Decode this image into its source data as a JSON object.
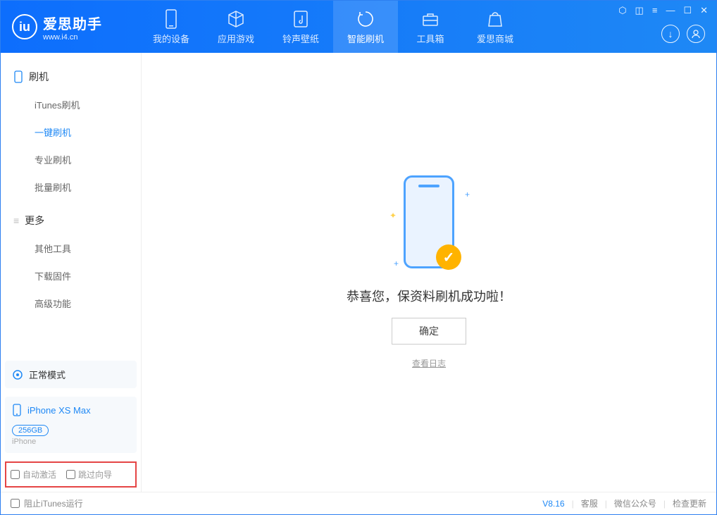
{
  "app": {
    "title": "爱思助手",
    "subtitle": "www.i4.cn"
  },
  "tabs": {
    "device": "我的设备",
    "apps": "应用游戏",
    "ring": "铃声壁纸",
    "flash": "智能刷机",
    "tools": "工具箱",
    "store": "爱思商城"
  },
  "sidebar": {
    "flash_head": "刷机",
    "itunes_flash": "iTunes刷机",
    "one_click": "一键刷机",
    "pro_flash": "专业刷机",
    "batch_flash": "批量刷机",
    "more_head": "更多",
    "other_tools": "其他工具",
    "download_fw": "下载固件",
    "advanced": "高级功能"
  },
  "device": {
    "mode": "正常模式",
    "name": "iPhone XS Max",
    "capacity": "256GB",
    "type": "iPhone"
  },
  "checks": {
    "auto_activate": "自动激活",
    "skip_wizard": "跳过向导"
  },
  "main": {
    "success": "恭喜您，保资料刷机成功啦！",
    "ok": "确定",
    "view_log": "查看日志"
  },
  "footer": {
    "block_itunes": "阻止iTunes运行",
    "version": "V8.16",
    "kefu": "客服",
    "wechat": "微信公众号",
    "update": "检查更新"
  }
}
